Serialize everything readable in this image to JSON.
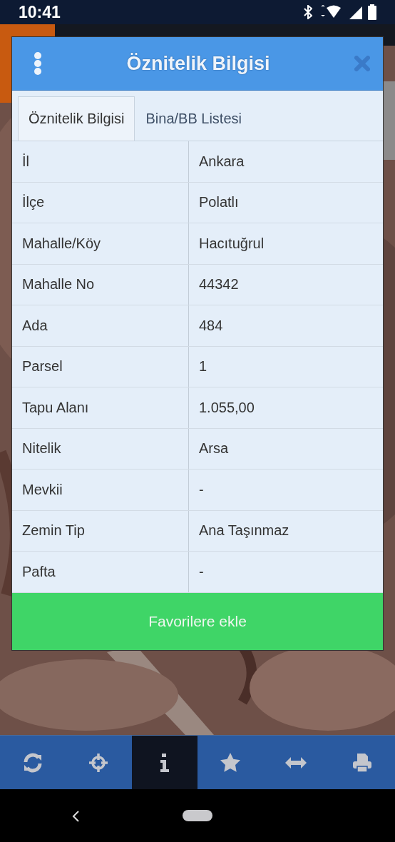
{
  "status_bar": {
    "time": "10:41"
  },
  "dialog": {
    "title": "Öznitelik Bilgisi",
    "tabs": [
      {
        "label": "Öznitelik Bilgisi",
        "selected": true
      },
      {
        "label": "Bina/BB Listesi",
        "selected": false
      }
    ],
    "rows": [
      {
        "label": "İl",
        "value": "Ankara"
      },
      {
        "label": "İlçe",
        "value": "Polatlı"
      },
      {
        "label": "Mahalle/Köy",
        "value": "Hacıtuğrul"
      },
      {
        "label": "Mahalle No",
        "value": "44342"
      },
      {
        "label": "Ada",
        "value": "484"
      },
      {
        "label": "Parsel",
        "value": "1"
      },
      {
        "label": "Tapu Alanı",
        "value": "1.055,00"
      },
      {
        "label": "Nitelik",
        "value": "Arsa"
      },
      {
        "label": "Mevkii",
        "value": "-"
      },
      {
        "label": "Zemin Tip",
        "value": "Ana Taşınmaz"
      },
      {
        "label": "Pafta",
        "value": "-"
      }
    ],
    "button": "Favorilere ekle"
  },
  "toolbar": {
    "items": [
      {
        "kind": "refresh",
        "selected": false
      },
      {
        "kind": "locate",
        "selected": false
      },
      {
        "kind": "info",
        "selected": true
      },
      {
        "kind": "star",
        "selected": false
      },
      {
        "kind": "measure",
        "selected": false
      },
      {
        "kind": "print",
        "selected": false
      }
    ]
  }
}
